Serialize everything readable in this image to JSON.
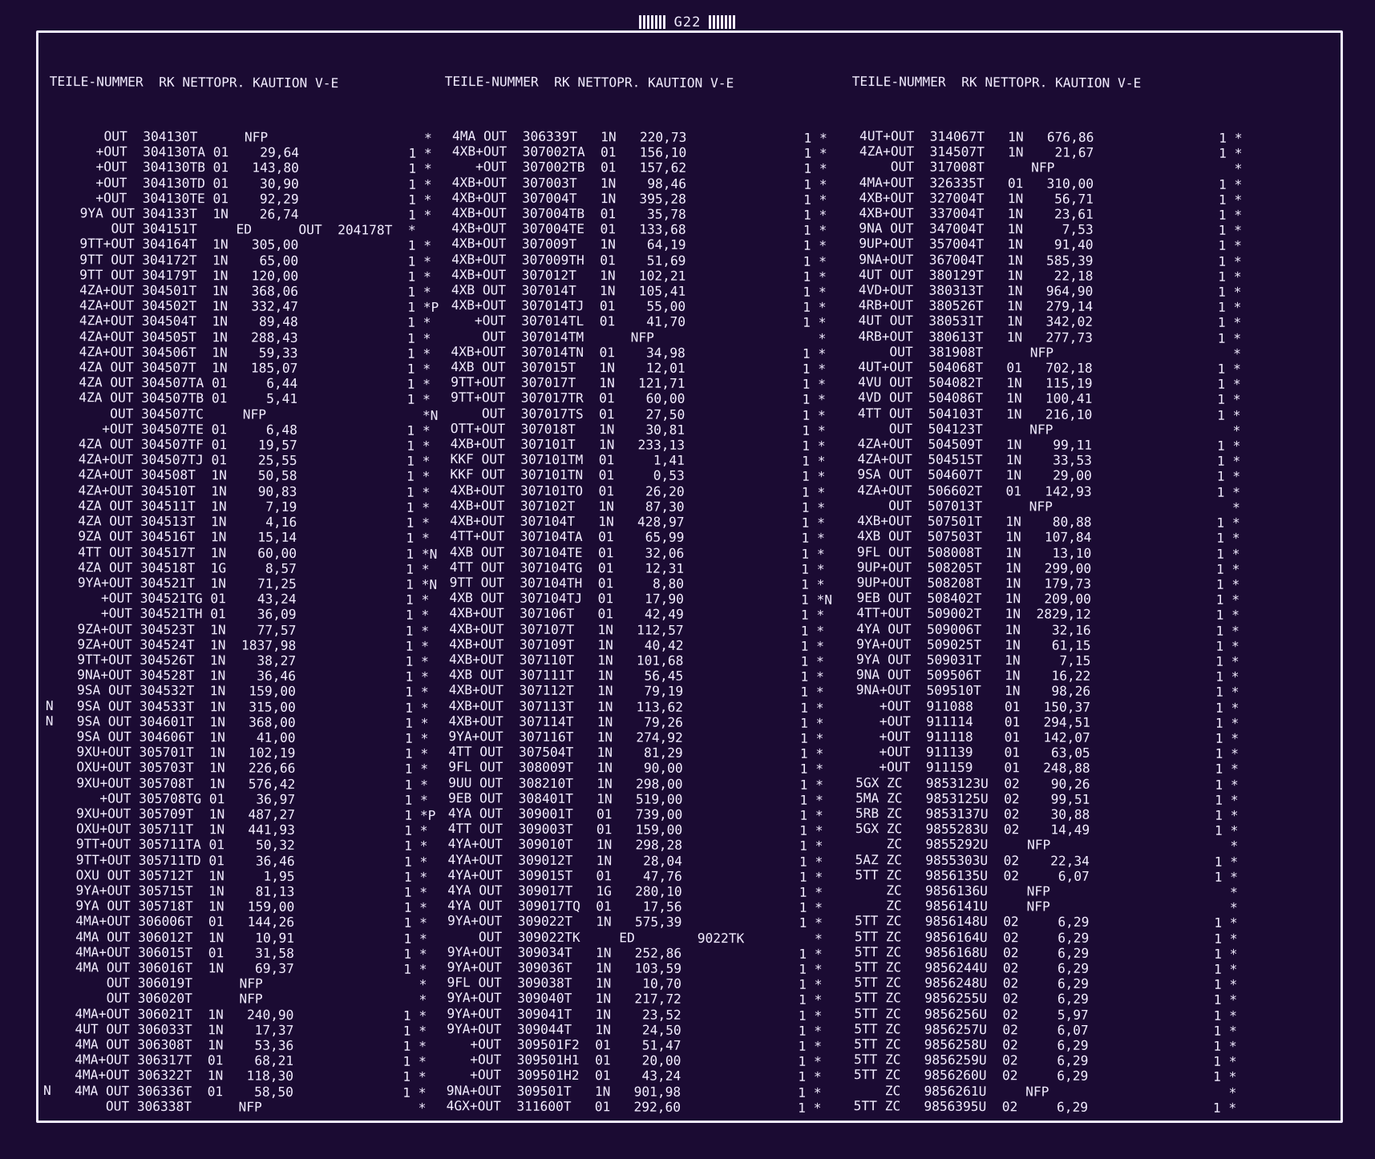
{
  "page_label": "G22",
  "header_line": "TEILE-NUMMER  RK NETTOPR. KAUTION V-E",
  "columns": [
    {
      "rows": [
        "       OUT  304130T      NFP                    *",
        "      +OUT  304130TA 01    29,64              1 *",
        "      +OUT  304130TB 01   143,80              1 *",
        "      +OUT  304130TD 01    30,90              1 *",
        "      +OUT  304130TE 01    92,29              1 *",
        "    9YA OUT 304133T  1N    26,74              1 *",
        "        OUT 304151T     ED      OUT  204178T  *",
        "    9TT+OUT 304164T  1N   305,00              1 *",
        "    9TT OUT 304172T  1N    65,00              1 *",
        "    9TT OUT 304179T  1N   120,00              1 *",
        "    4ZA+OUT 304501T  1N   368,06              1 *",
        "    4ZA+OUT 304502T  1N   332,47              1 *P",
        "    4ZA+OUT 304504T  1N    89,48              1 *",
        "    4ZA+OUT 304505T  1N   288,43              1 *",
        "    4ZA+OUT 304506T  1N    59,33              1 *",
        "    4ZA OUT 304507T  1N   185,07              1 *",
        "    4ZA OUT 304507TA 01     6,44              1 *",
        "    4ZA OUT 304507TB 01     5,41              1 *",
        "        OUT 304507TC     NFP                    *N",
        "       +OUT 304507TE 01     6,48              1 *",
        "    4ZA OUT 304507TF 01    19,57              1 *",
        "    4ZA+OUT 304507TJ 01    25,55              1 *",
        "    4ZA+OUT 304508T  1N    50,58              1 *",
        "    4ZA+OUT 304510T  1N    90,83              1 *",
        "    4ZA OUT 304511T  1N     7,19              1 *",
        "    4ZA OUT 304513T  1N     4,16              1 *",
        "    9ZA OUT 304516T  1N    15,14              1 *",
        "    4TT OUT 304517T  1N    60,00              1 *N",
        "    4ZA OUT 304518T  1G     8,57              1 *",
        "    9YA+OUT 304521T  1N    71,25              1 *N",
        "       +OUT 304521TG 01    43,24              1 *",
        "       +OUT 304521TH 01    36,09              1 *",
        "    9ZA+OUT 304523T  1N    77,57              1 *",
        "    9ZA+OUT 304524T  1N  1837,98              1 *",
        "    9TT+OUT 304526T  1N    38,27              1 *",
        "    9NA+OUT 304528T  1N    36,46              1 *",
        "    9SA OUT 304532T  1N   159,00              1 *",
        "N   9SA OUT 304533T  1N   315,00              1 *",
        "N   9SA OUT 304601T  1N   368,00              1 *",
        "    9SA OUT 304606T  1N    41,00              1 *",
        "    9XU+OUT 305701T  1N   102,19              1 *",
        "    OXU+OUT 305703T  1N   226,66              1 *",
        "    9XU+OUT 305708T  1N   576,42              1 *",
        "       +OUT 305708TG 01    36,97              1 *",
        "    9XU+OUT 305709T  1N   487,27              1 *P",
        "    OXU+OUT 305711T  1N   441,93              1 *",
        "    9TT+OUT 305711TA 01    50,32              1 *",
        "    9TT+OUT 305711TD 01    36,46              1 *",
        "    OXU OUT 305712T  1N     1,95              1 *",
        "    9YA+OUT 305715T  1N    81,13              1 *",
        "    9YA OUT 305718T  1N   159,00              1 *",
        "    4MA+OUT 306006T  01   144,26              1 *",
        "    4MA OUT 306012T  1N    10,91              1 *",
        "    4MA+OUT 306015T  01    31,58              1 *",
        "    4MA OUT 306016T  1N    69,37              1 *",
        "        OUT 306019T      NFP                    *",
        "        OUT 306020T      NFP                    *",
        "    4MA+OUT 306021T  1N   240,90              1 *",
        "    4UT OUT 306033T  1N    17,37              1 *",
        "    4MA OUT 306308T  1N    53,36              1 *",
        "    4MA+OUT 306317T  01    68,21              1 *",
        "    4MA+OUT 306322T  1N   118,30              1 *",
        "N   4MA OUT 306336T  01    58,50              1 *",
        "        OUT 306338T      NFP                    *"
      ]
    },
    {
      "rows": [
        " 4MA OUT  306339T   1N   220,73               1 *",
        " 4XB+OUT  307002TA  01   156,10               1 *",
        "    +OUT  307002TB  01   157,62               1 *",
        " 4XB+OUT  307003T   1N    98,46               1 *",
        " 4XB+OUT  307004T   1N   395,28               1 *",
        " 4XB+OUT  307004TB  01    35,78               1 *",
        " 4XB+OUT  307004TE  01   133,68               1 *",
        " 4XB+OUT  307009T   1N    64,19               1 *",
        " 4XB+OUT  307009TH  01    51,69               1 *",
        " 4XB+OUT  307012T   1N   102,21               1 *",
        " 4XB OUT  307014T   1N   105,41               1 *",
        " 4XB+OUT  307014TJ  01    55,00               1 *",
        "    +OUT  307014TL  01    41,70               1 *",
        "     OUT  307014TM      NFP                     *",
        " 4XB+OUT  307014TN  01    34,98               1 *",
        " 4XB OUT  307015T   1N    12,01               1 *",
        " 9TT+OUT  307017T   1N   121,71               1 *",
        " 9TT+OUT  307017TR  01    60,00               1 *",
        "     OUT  307017TS  01    27,50               1 *",
        " OTT+OUT  307018T   1N    30,81               1 *",
        " 4XB+OUT  307101T   1N   233,13               1 *",
        " KKF OUT  307101TM  01     1,41               1 *",
        " KKF OUT  307101TN  01     0,53               1 *",
        " 4XB+OUT  307101TO  01    26,20               1 *",
        " 4XB+OUT  307102T   1N    87,30               1 *",
        " 4XB+OUT  307104T   1N   428,97               1 *",
        " 4TT+OUT  307104TA  01    65,99               1 *",
        " 4XB OUT  307104TE  01    32,06               1 *",
        " 4TT OUT  307104TG  01    12,31               1 *",
        " 9TT OUT  307104TH  01     8,80               1 *",
        " 4XB OUT  307104TJ  01    17,90               1 *N",
        " 4XB+OUT  307106T   01    42,49               1 *",
        " 4XB+OUT  307107T   1N   112,57               1 *",
        " 4XB+OUT  307109T   1N    40,42               1 *",
        " 4XB+OUT  307110T   1N   101,68               1 *",
        " 4XB OUT  307111T   1N    56,45               1 *",
        " 4XB+OUT  307112T   1N    79,19               1 *",
        " 4XB+OUT  307113T   1N   113,62               1 *",
        " 4XB+OUT  307114T   1N    79,26               1 *",
        " 9YA+OUT  307116T   1N   274,92               1 *",
        " 4TT OUT  307504T   1N    81,29               1 *",
        " 9FL OUT  308009T   1N    90,00               1 *",
        " 9UU OUT  308210T   1N   298,00               1 *",
        " 9EB OUT  308401T   1N   519,00               1 *",
        " 4YA OUT  309001T   01   739,00               1 *",
        " 4TT OUT  309003T   01   159,00               1 *",
        " 4YA+OUT  309010T   1N   298,28               1 *",
        " 4YA+OUT  309012T   1N    28,04               1 *",
        " 4YA+OUT  309015T   01    47,76               1 *",
        " 4YA OUT  309017T   1G   280,10               1 *",
        " 4YA OUT  309017TQ  01    17,56               1 *",
        " 9YA+OUT  309022T   1N   575,39               1 *",
        "     OUT  309022TK     ED        9022TK         *",
        " 9YA+OUT  309034T   1N   252,86               1 *",
        " 9YA+OUT  309036T   1N   103,59               1 *",
        " 9FL OUT  309038T   1N    10,70               1 *",
        " 9YA+OUT  309040T   1N   217,72               1 *",
        " 9YA+OUT  309041T   1N    23,52               1 *",
        " 9YA+OUT  309044T   1N    24,50               1 *",
        "    +OUT  309501F2  01    51,47               1 *",
        "    +OUT  309501H1  01    20,00               1 *",
        "    +OUT  309501H2  01    43,24               1 *",
        " 9NA+OUT  309501T   1N   901,98               1 *",
        " 4GX+OUT  311600T   01   292,60               1 *"
      ]
    },
    {
      "rows": [
        " 4UT+OUT  314067T   1N   676,86                1 *",
        " 4ZA+OUT  314507T   1N    21,67                1 *",
        "     OUT  317008T      NFP                       *",
        " 4MA+OUT  326335T   01   310,00                1 *",
        " 4XB+OUT  327004T   1N    56,71                1 *",
        " 4XB+OUT  337004T   1N    23,61                1 *",
        " 9NA OUT  347004T   1N     7,53                1 *",
        " 9UP+OUT  357004T   1N    91,40                1 *",
        " 9NA+OUT  367004T   1N   585,39                1 *",
        " 4UT OUT  380129T   1N    22,18                1 *",
        " 4VD+OUT  380313T   1N   964,90                1 *",
        " 4RB+OUT  380526T   1N   279,14                1 *",
        " 4UT OUT  380531T   1N   342,02                1 *",
        " 4RB+OUT  380613T   1N   277,73                1 *",
        "     OUT  381908T      NFP                       *",
        " 4UT+OUT  504068T   01   702,18                1 *",
        " 4VU OUT  504082T   1N   115,19                1 *",
        " 4VD OUT  504086T   1N   100,41                1 *",
        " 4TT OUT  504103T   1N   216,10                1 *",
        "     OUT  504123T      NFP                       *",
        " 4ZA+OUT  504509T   1N    99,11                1 *",
        " 4ZA+OUT  504515T   1N    33,53                1 *",
        " 9SA OUT  504607T   1N    29,00                1 *",
        " 4ZA+OUT  506602T   01   142,93                1 *",
        "     OUT  507013T      NFP                       *",
        " 4XB+OUT  507501T   1N    80,88                1 *",
        " 4XB OUT  507503T   1N   107,84                1 *",
        " 9FL OUT  508008T   1N    13,10                1 *",
        " 9UP+OUT  508205T   1N   299,00                1 *",
        " 9UP+OUT  508208T   1N   179,73                1 *",
        " 9EB OUT  508402T   1N   209,00                1 *",
        " 4TT+OUT  509002T   1N  2829,12                1 *",
        " 4YA OUT  509006T   1N    32,16                1 *",
        " 9YA+OUT  509025T   1N    61,15                1 *",
        " 9YA OUT  509031T   1N     7,15                1 *",
        " 9NA OUT  509506T   1N    16,22                1 *",
        " 9NA+OUT  509510T   1N    98,26                1 *",
        "    +OUT  911088    01   150,37                1 *",
        "    +OUT  911114    01   294,51                1 *",
        "    +OUT  911118    01   142,07                1 *",
        "    +OUT  911139    01    63,05                1 *",
        "    +OUT  911159    01   248,88                1 *",
        " 5GX ZC   9853123U  02    90,26                1 *",
        " 5MA ZC   9853125U  02    99,51                1 *",
        " 5RB ZC   9853137U  02    30,88                1 *",
        " 5GX ZC   9855283U  02    14,49                1 *",
        "     ZC   9855292U     NFP                       *",
        " 5AZ ZC   9855303U  02    22,34                1 *",
        " 5TT ZC   9856135U  02     6,07                1 *",
        "     ZC   9856136U     NFP                       *",
        "     ZC   9856141U     NFP                       *",
        " 5TT ZC   9856148U  02     6,29                1 *",
        " 5TT ZC   9856164U  02     6,29                1 *",
        " 5TT ZC   9856168U  02     6,29                1 *",
        " 5TT ZC   9856244U  02     6,29                1 *",
        " 5TT ZC   9856248U  02     6,29                1 *",
        " 5TT ZC   9856255U  02     6,29                1 *",
        " 5TT ZC   9856256U  02     5,97                1 *",
        " 5TT ZC   9856257U  02     6,07                1 *",
        " 5TT ZC   9856258U  02     6,29                1 *",
        " 5TT ZC   9856259U  02     6,29                1 *",
        " 5TT ZC   9856260U  02     6,29                1 *",
        "     ZC   9856261U     NFP                       *",
        " 5TT ZC   9856395U  02     6,29                1 *"
      ]
    }
  ]
}
